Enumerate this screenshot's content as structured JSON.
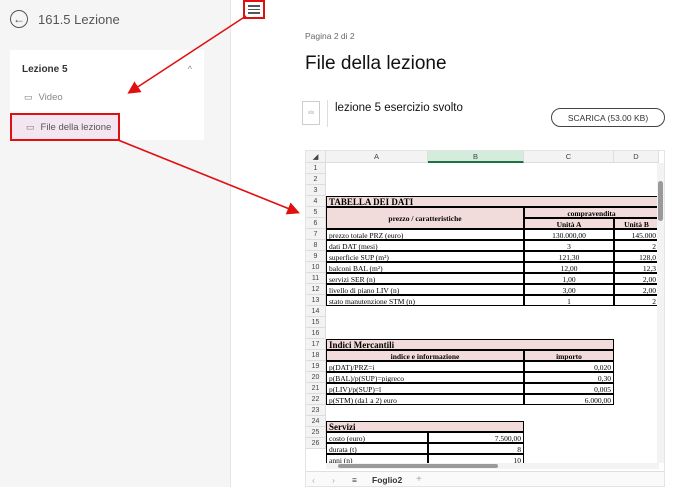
{
  "sidebar": {
    "course_title": "161.5 Lezione",
    "section_title": "Lezione 5",
    "items": [
      {
        "label": "Video"
      },
      {
        "label": "File della lezione"
      }
    ]
  },
  "main": {
    "pager": "Pagina 2 di 2",
    "title": "File della lezione",
    "file": {
      "name": "lezione 5 esercizio svolto",
      "icon_text": "xls",
      "download_label": "SCARICA (53.00 KB)"
    }
  },
  "spreadsheet": {
    "columns": [
      "A",
      "B",
      "C",
      "D"
    ],
    "selected_column": "B",
    "rows": [
      "1",
      "2",
      "3",
      "4",
      "5",
      "6",
      "7",
      "8",
      "9",
      "10",
      "11",
      "12",
      "13",
      "14",
      "15",
      "16",
      "17",
      "18",
      "19",
      "20",
      "21",
      "22",
      "23",
      "24",
      "25",
      "26"
    ],
    "table1": {
      "title": "TABELLA DEI DATI",
      "header_left": "prezzo / caratteristiche",
      "header_group": "compravendita",
      "unit_a": "Unità A",
      "unit_b": "Unità B",
      "rows": [
        {
          "label": "prezzo totale PRZ (euro)",
          "a": "130.000,00",
          "b": "145.000"
        },
        {
          "label": "dati DAT (mesi)",
          "a": "3",
          "b": "2"
        },
        {
          "label": "superficie SUP (m²)",
          "a": "121,30",
          "b": "128,0"
        },
        {
          "label": "balconi BAL (m²)",
          "a": "12,00",
          "b": "12,3"
        },
        {
          "label": "servizi SER (n)",
          "a": "1,00",
          "b": "2,00"
        },
        {
          "label": "livello di piano LIV (n)",
          "a": "3,00",
          "b": "2,00"
        },
        {
          "label": "stato manutenzione STM (n)",
          "a": "1",
          "b": "2"
        }
      ]
    },
    "table2": {
      "title": "Indici Mercantili",
      "header_left": "indice e informazione",
      "header_right": "importo",
      "rows": [
        {
          "label": "p(DAT)/PRZ=i",
          "value": "0,020"
        },
        {
          "label": "p(BAL)/p(SUP)=pigreco",
          "value": "0,30"
        },
        {
          "label": "p(LIV)/p(SUP)=l",
          "value": "0,005"
        },
        {
          "label": "p(STM) (da1 a 2) euro",
          "value": "6.000,00"
        }
      ]
    },
    "table3": {
      "title": "Servizi",
      "rows": [
        {
          "label": "costo (euro)",
          "value": "7.500,00"
        },
        {
          "label": "durata (t)",
          "value": "8"
        },
        {
          "label": "anni (n)",
          "value": "10"
        }
      ]
    },
    "sheet_tab": "Foglio2"
  }
}
